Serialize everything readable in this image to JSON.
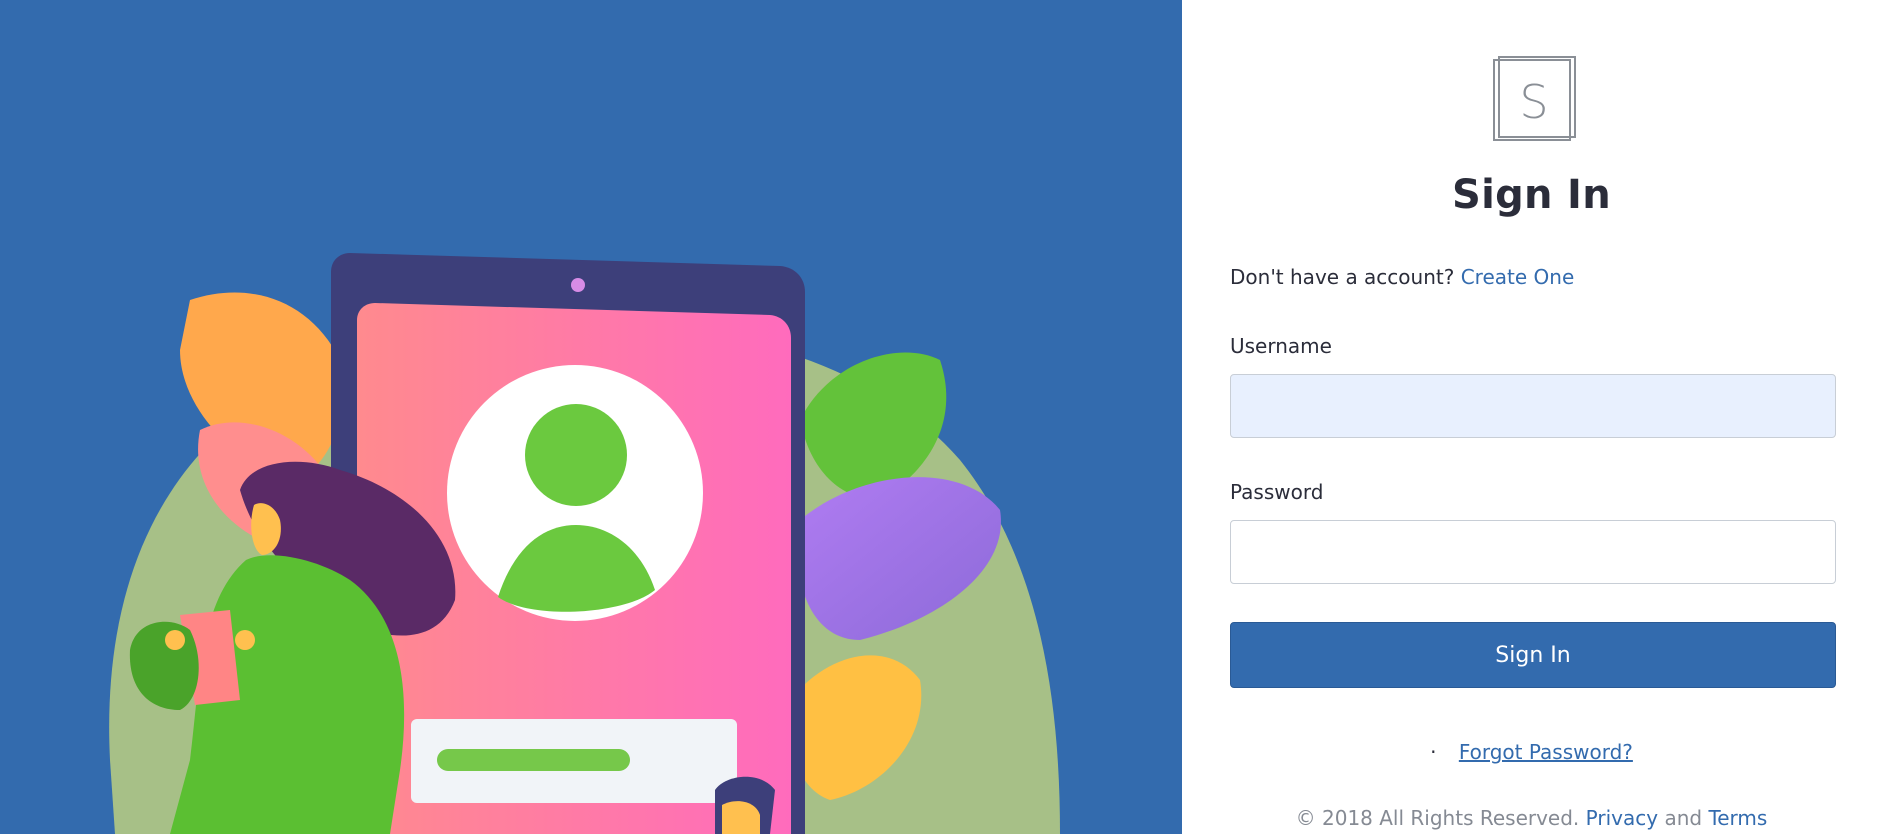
{
  "logo": {
    "letter": "S",
    "icon": "s-logo-icon"
  },
  "title": "Sign In",
  "signup": {
    "prompt": "Don't have a account?",
    "link": "Create One"
  },
  "fields": {
    "username": {
      "label": "Username",
      "value": "",
      "placeholder": ""
    },
    "password": {
      "label": "Password",
      "value": "",
      "placeholder": ""
    }
  },
  "submit_label": "Sign In",
  "forgot": {
    "bullet": "·",
    "link": "Forgot Password?"
  },
  "footer": {
    "copyright": "© 2018 All Rights Reserved.",
    "privacy": "Privacy",
    "and": "and",
    "terms": "Terms"
  },
  "colors": {
    "brand": "#336bae",
    "heading": "#2b2d3a",
    "input_autofill": "#e8f0fe"
  }
}
